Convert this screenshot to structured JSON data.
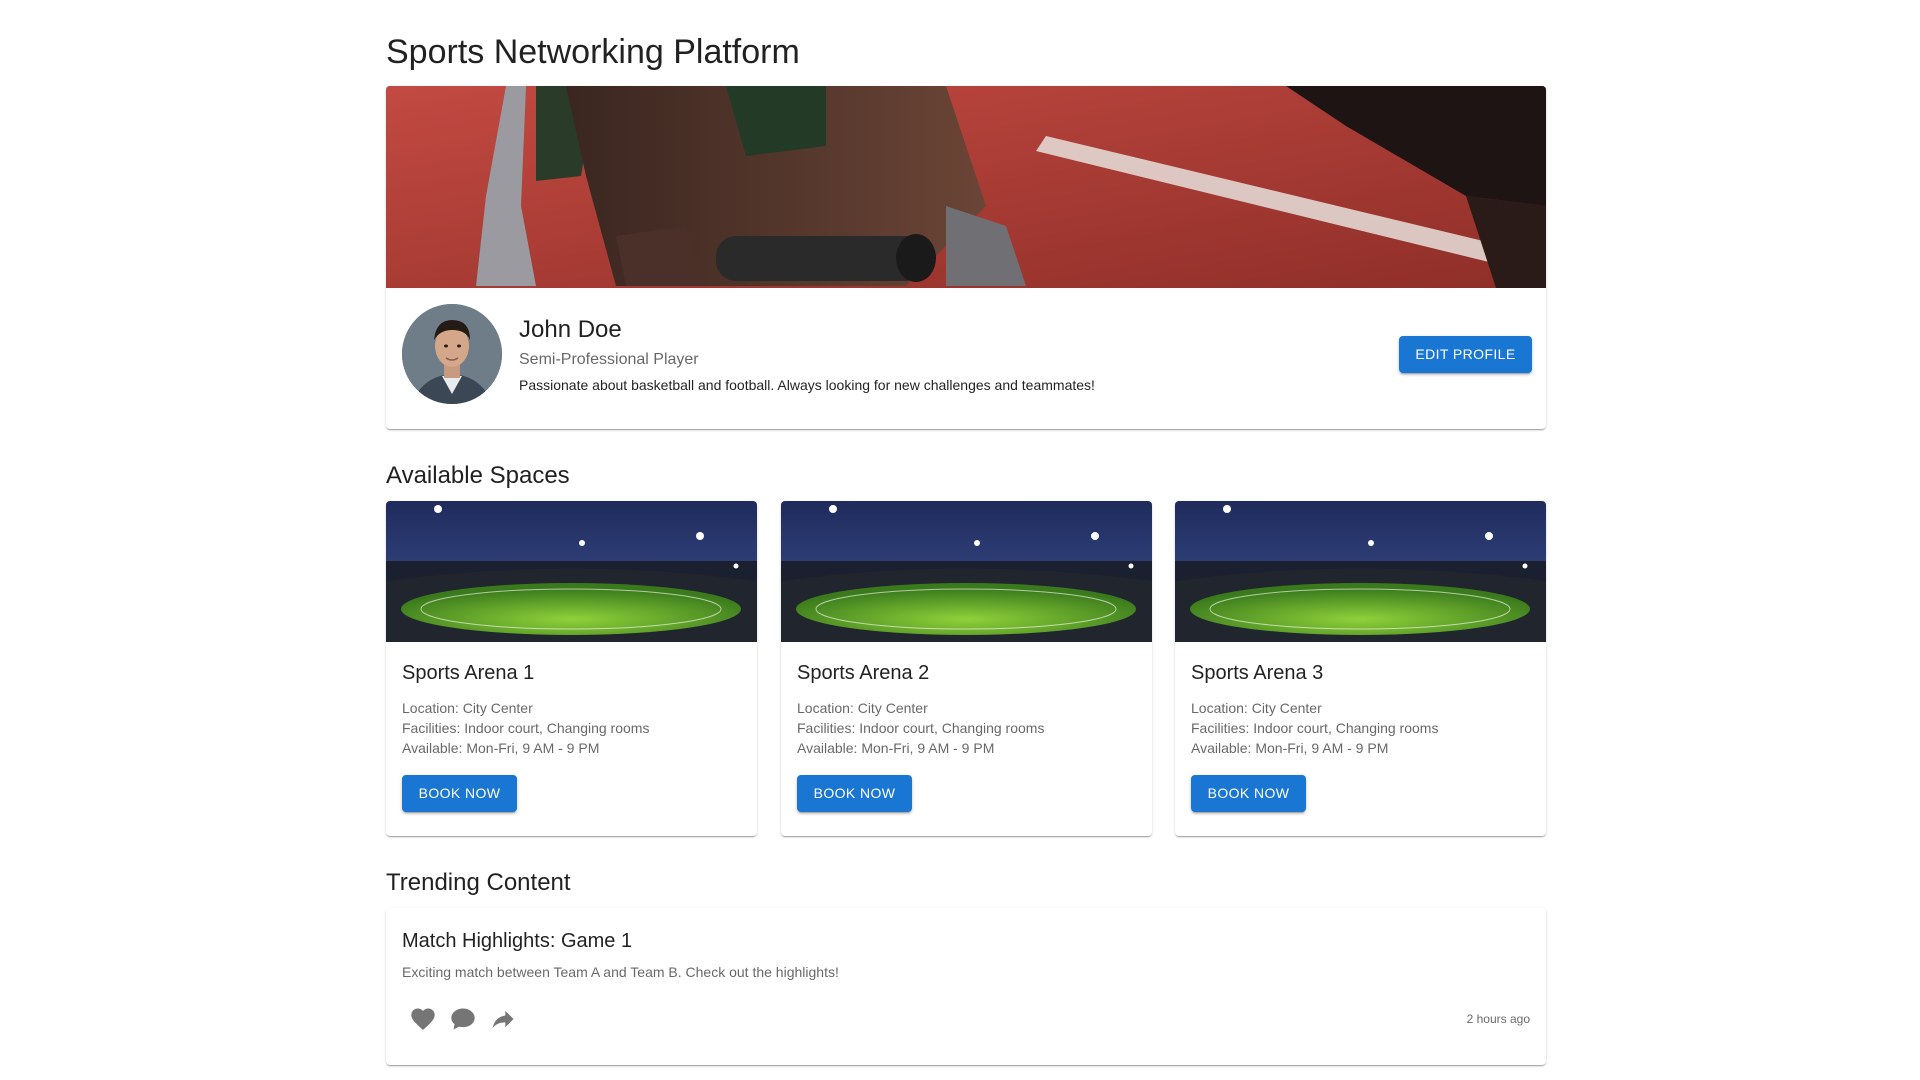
{
  "page": {
    "title": "Sports Networking Platform"
  },
  "profile": {
    "name": "John Doe",
    "role": "Semi-Professional Player",
    "bio": "Passionate about basketball and football. Always looking for new challenges and teammates!",
    "edit_label": "EDIT PROFILE"
  },
  "spaces": {
    "section_title": "Available Spaces",
    "items": [
      {
        "name": "Sports Arena 1",
        "location": "Location: City Center",
        "facilities": "Facilities: Indoor court, Changing rooms",
        "available": "Available: Mon-Fri, 9 AM - 9 PM",
        "book_label": "BOOK NOW"
      },
      {
        "name": "Sports Arena 2",
        "location": "Location: City Center",
        "facilities": "Facilities: Indoor court, Changing rooms",
        "available": "Available: Mon-Fri, 9 AM - 9 PM",
        "book_label": "BOOK NOW"
      },
      {
        "name": "Sports Arena 3",
        "location": "Location: City Center",
        "facilities": "Facilities: Indoor court, Changing rooms",
        "available": "Available: Mon-Fri, 9 AM - 9 PM",
        "book_label": "BOOK NOW"
      }
    ]
  },
  "trending": {
    "section_title": "Trending Content",
    "items": [
      {
        "title": "Match Highlights: Game 1",
        "description": "Exciting match between Team A and Team B. Check out the highlights!",
        "time": "2 hours ago"
      }
    ]
  },
  "icons": {
    "like": "heart-icon",
    "comment": "comment-icon",
    "share": "share-icon"
  },
  "colors": {
    "primary": "#1976d2",
    "icon_gray": "#757575"
  }
}
